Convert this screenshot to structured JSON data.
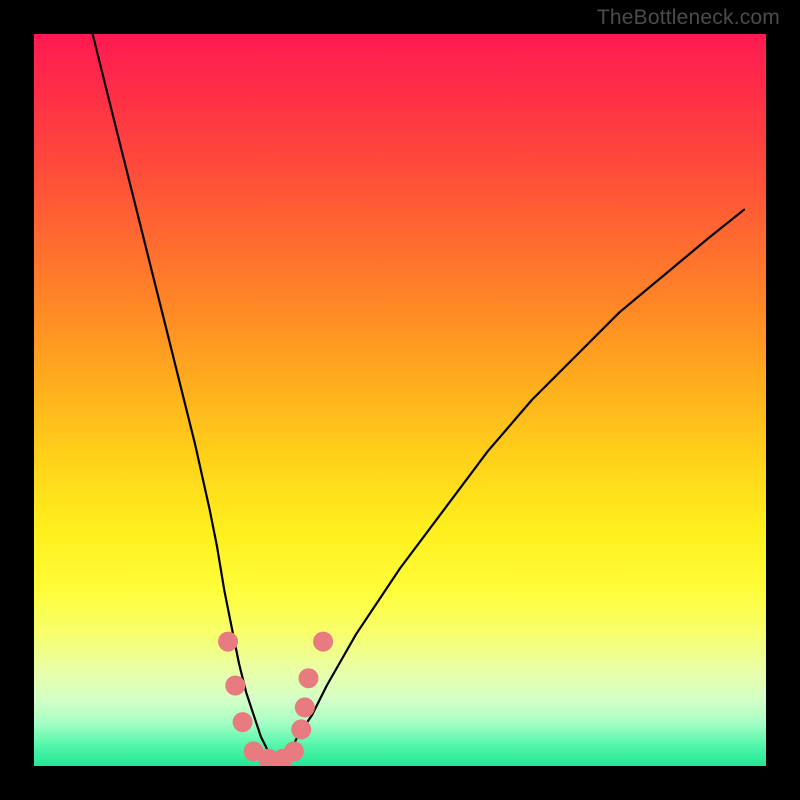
{
  "watermark": {
    "text": "TheBottleneck.com"
  },
  "colors": {
    "curve_stroke": "#000000",
    "marker_fill": "#e77b7f",
    "green_band": "#1fe896"
  },
  "chart_data": {
    "type": "line",
    "title": "",
    "xlabel": "",
    "ylabel": "",
    "xlim": [
      0,
      100
    ],
    "ylim": [
      0,
      100
    ],
    "grid": false,
    "legend": false,
    "note": "Axes have no tick labels; coordinates are fractional (0–100) positions within the plot area with origin at bottom-left. Values are visual estimates.",
    "series": [
      {
        "name": "bottleneck-curve",
        "x": [
          8,
          10,
          12,
          14,
          16,
          18,
          20,
          22,
          24,
          25,
          26,
          27,
          28,
          29,
          30,
          31,
          32,
          33,
          34,
          35,
          36,
          38,
          40,
          44,
          50,
          56,
          62,
          68,
          74,
          80,
          86,
          92,
          97
        ],
        "y": [
          100,
          92,
          84,
          76,
          68,
          60,
          52,
          44,
          35,
          30,
          24,
          19,
          14,
          10,
          7,
          4,
          2,
          1,
          1,
          2,
          4,
          7,
          11,
          18,
          27,
          35,
          43,
          50,
          56,
          62,
          67,
          72,
          76
        ]
      }
    ],
    "markers": {
      "name": "trough-markers",
      "points": [
        {
          "x": 26.5,
          "y": 17
        },
        {
          "x": 27.5,
          "y": 11
        },
        {
          "x": 28.5,
          "y": 6
        },
        {
          "x": 30.0,
          "y": 2
        },
        {
          "x": 32.0,
          "y": 1
        },
        {
          "x": 34.0,
          "y": 1
        },
        {
          "x": 35.5,
          "y": 2
        },
        {
          "x": 36.5,
          "y": 5
        },
        {
          "x": 37.0,
          "y": 8
        },
        {
          "x": 37.5,
          "y": 12
        },
        {
          "x": 39.5,
          "y": 17
        }
      ],
      "radius": 10
    }
  }
}
